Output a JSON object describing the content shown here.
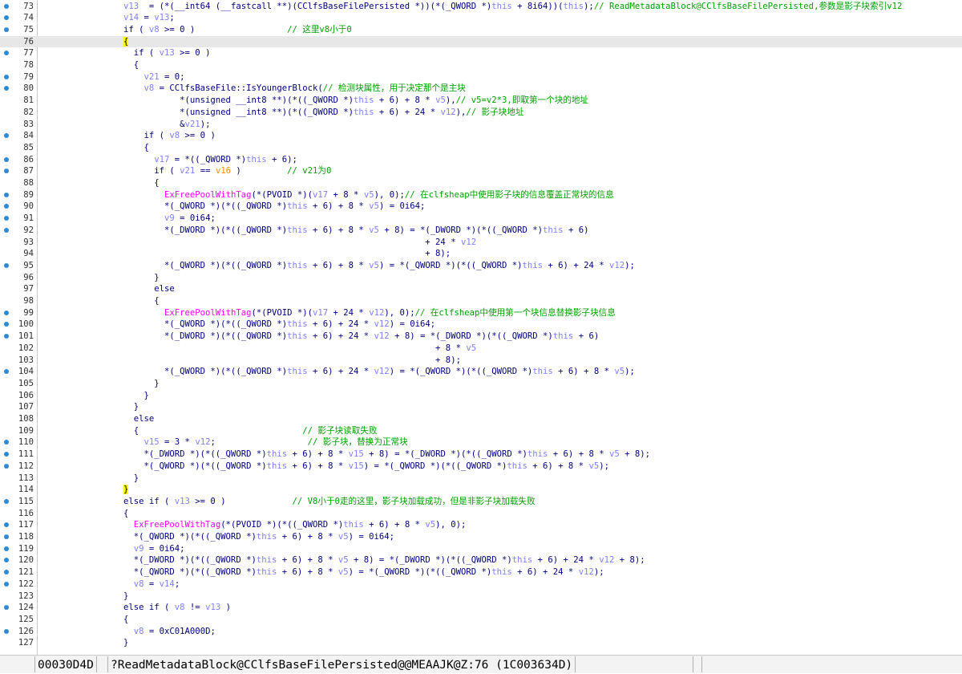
{
  "status_bar": {
    "address": "00030D4D",
    "location": "?ReadMetadataBlock@CClfsBaseFilePersisted@@MEAAJK@Z:76 (1C003634D)"
  },
  "colors": {
    "keyword": "#00007f",
    "variable": "#7f7fff",
    "comment": "#00a000",
    "import_function": "#ff00ff",
    "highlight": "#ffff00",
    "current_line": "#e7e7e7",
    "breakpoint_dot": "#2c8ad8"
  },
  "lines": [
    {
      "n": "73",
      "dot": true,
      "segs": [
        [
          "v",
          "v13"
        ],
        [
          "",
          "  = (*(__int64 (__fastcall **)(CClfsBaseFilePersisted *))(*(_QWORD *)"
        ],
        [
          "v",
          "this"
        ],
        [
          "",
          " + 8i64))("
        ],
        [
          "v",
          "this"
        ],
        [
          "",
          ");"
        ],
        [
          "c",
          "// ReadMetadataBlock@CClfsBaseFilePersisted,参数是影子块索引v12"
        ]
      ]
    },
    {
      "n": "74",
      "dot": true,
      "segs": [
        [
          "v",
          "v14"
        ],
        [
          "",
          " = "
        ],
        [
          "v",
          "v13"
        ],
        [
          "",
          ";"
        ]
      ]
    },
    {
      "n": "75",
      "dot": true,
      "segs": [
        [
          "",
          "if ( "
        ],
        [
          "v",
          "v8"
        ],
        [
          "",
          " >= 0 )                  "
        ],
        [
          "c",
          "// 这里v8小于0"
        ]
      ]
    },
    {
      "n": "76",
      "dot": false,
      "current": true,
      "segs": [
        [
          "hl",
          "{"
        ]
      ]
    },
    {
      "n": "77",
      "dot": true,
      "segs": [
        [
          "",
          "  if ( "
        ],
        [
          "v",
          "v13"
        ],
        [
          "",
          " >= 0 )"
        ]
      ]
    },
    {
      "n": "78",
      "dot": false,
      "segs": [
        [
          "",
          "  {"
        ]
      ]
    },
    {
      "n": "79",
      "dot": true,
      "segs": [
        [
          "",
          "    "
        ],
        [
          "v",
          "v21"
        ],
        [
          "",
          " = 0;"
        ]
      ]
    },
    {
      "n": "80",
      "dot": true,
      "segs": [
        [
          "",
          "    "
        ],
        [
          "v",
          "v8"
        ],
        [
          "",
          " = CClfsBaseFile::IsYoungerBlock("
        ],
        [
          "c",
          "// 检测块属性，用于决定那个是主块"
        ]
      ]
    },
    {
      "n": "81",
      "dot": false,
      "segs": [
        [
          "",
          "           *(unsigned __int8 **)(*((_QWORD *)"
        ],
        [
          "v",
          "this"
        ],
        [
          "",
          " + 6) + 8 * "
        ],
        [
          "v",
          "v5"
        ],
        [
          "",
          "),"
        ],
        [
          "c",
          "// v5=v2*3,即取第一个块的地址"
        ]
      ]
    },
    {
      "n": "82",
      "dot": false,
      "segs": [
        [
          "",
          "           *(unsigned __int8 **)(*((_QWORD *)"
        ],
        [
          "v",
          "this"
        ],
        [
          "",
          " + 6) + 24 * "
        ],
        [
          "v",
          "v12"
        ],
        [
          "",
          "),"
        ],
        [
          "c",
          "// 影子块地址"
        ]
      ]
    },
    {
      "n": "83",
      "dot": false,
      "segs": [
        [
          "",
          "           &"
        ],
        [
          "v",
          "v21"
        ],
        [
          "",
          ");"
        ]
      ]
    },
    {
      "n": "84",
      "dot": true,
      "segs": [
        [
          "",
          "    if ( "
        ],
        [
          "v",
          "v8"
        ],
        [
          "",
          " >= 0 )"
        ]
      ]
    },
    {
      "n": "85",
      "dot": false,
      "segs": [
        [
          "",
          "    {"
        ]
      ]
    },
    {
      "n": "86",
      "dot": true,
      "segs": [
        [
          "",
          "      "
        ],
        [
          "v",
          "v17"
        ],
        [
          "",
          " = *((_QWORD *)"
        ],
        [
          "v",
          "this"
        ],
        [
          "",
          " + 6);"
        ]
      ]
    },
    {
      "n": "87",
      "dot": true,
      "segs": [
        [
          "",
          "      if ( "
        ],
        [
          "v",
          "v21"
        ],
        [
          "",
          " == "
        ],
        [
          "o",
          "v16"
        ],
        [
          "",
          " )         "
        ],
        [
          "c",
          "// v21为0"
        ]
      ]
    },
    {
      "n": "88",
      "dot": false,
      "segs": [
        [
          "",
          "      {"
        ]
      ]
    },
    {
      "n": "89",
      "dot": true,
      "segs": [
        [
          "",
          "        "
        ],
        [
          "f",
          "ExFreePoolWithTag"
        ],
        [
          "",
          "(*(PVOID *)("
        ],
        [
          "v",
          "v17"
        ],
        [
          "",
          " + 8 * "
        ],
        [
          "v",
          "v5"
        ],
        [
          "",
          "), 0);"
        ],
        [
          "c",
          "// 在clfsheap中使用影子块的信息覆盖正常块的信息"
        ]
      ]
    },
    {
      "n": "90",
      "dot": true,
      "segs": [
        [
          "",
          "        *(_QWORD *)(*((_QWORD *)"
        ],
        [
          "v",
          "this"
        ],
        [
          "",
          " + 6) + 8 * "
        ],
        [
          "v",
          "v5"
        ],
        [
          "",
          ") = 0i64;"
        ]
      ]
    },
    {
      "n": "91",
      "dot": true,
      "segs": [
        [
          "",
          "        "
        ],
        [
          "v",
          "v9"
        ],
        [
          "",
          " = 0i64;"
        ]
      ]
    },
    {
      "n": "92",
      "dot": true,
      "segs": [
        [
          "",
          "        *(_DWORD *)(*((_QWORD *)"
        ],
        [
          "v",
          "this"
        ],
        [
          "",
          " + 6) + 8 * "
        ],
        [
          "v",
          "v5"
        ],
        [
          "",
          " + 8) = *(_DWORD *)(*((_QWORD *)"
        ],
        [
          "v",
          "this"
        ],
        [
          "",
          " + 6)"
        ]
      ]
    },
    {
      "n": "93",
      "dot": false,
      "segs": [
        [
          "",
          "                                                           + 24 * "
        ],
        [
          "v",
          "v12"
        ]
      ]
    },
    {
      "n": "94",
      "dot": false,
      "segs": [
        [
          "",
          "                                                           + 8);"
        ]
      ]
    },
    {
      "n": "95",
      "dot": true,
      "segs": [
        [
          "",
          "        *(_QWORD *)(*((_QWORD *)"
        ],
        [
          "v",
          "this"
        ],
        [
          "",
          " + 6) + 8 * "
        ],
        [
          "v",
          "v5"
        ],
        [
          "",
          ") = *(_QWORD *)(*((_QWORD *)"
        ],
        [
          "v",
          "this"
        ],
        [
          "",
          " + 6) + 24 * "
        ],
        [
          "v",
          "v12"
        ],
        [
          "",
          ");"
        ]
      ]
    },
    {
      "n": "96",
      "dot": false,
      "segs": [
        [
          "",
          "      }"
        ]
      ]
    },
    {
      "n": "97",
      "dot": false,
      "segs": [
        [
          "",
          "      else"
        ]
      ]
    },
    {
      "n": "98",
      "dot": false,
      "segs": [
        [
          "",
          "      {"
        ]
      ]
    },
    {
      "n": "99",
      "dot": true,
      "segs": [
        [
          "",
          "        "
        ],
        [
          "f",
          "ExFreePoolWithTag"
        ],
        [
          "",
          "(*(PVOID *)("
        ],
        [
          "v",
          "v17"
        ],
        [
          "",
          " + 24 * "
        ],
        [
          "v",
          "v12"
        ],
        [
          "",
          "), 0);"
        ],
        [
          "c",
          "// 在clfsheap中使用第一个块信息替换影子块信息"
        ]
      ]
    },
    {
      "n": "100",
      "dot": true,
      "segs": [
        [
          "",
          "        *(_QWORD *)(*((_QWORD *)"
        ],
        [
          "v",
          "this"
        ],
        [
          "",
          " + 6) + 24 * "
        ],
        [
          "v",
          "v12"
        ],
        [
          "",
          ") = 0i64;"
        ]
      ]
    },
    {
      "n": "101",
      "dot": true,
      "segs": [
        [
          "",
          "        *(_DWORD *)(*((_QWORD *)"
        ],
        [
          "v",
          "this"
        ],
        [
          "",
          " + 6) + 24 * "
        ],
        [
          "v",
          "v12"
        ],
        [
          "",
          " + 8) = *(_DWORD *)(*((_QWORD *)"
        ],
        [
          "v",
          "this"
        ],
        [
          "",
          " + 6)"
        ]
      ]
    },
    {
      "n": "102",
      "dot": false,
      "segs": [
        [
          "",
          "                                                             + 8 * "
        ],
        [
          "v",
          "v5"
        ]
      ]
    },
    {
      "n": "103",
      "dot": false,
      "segs": [
        [
          "",
          "                                                             + 8);"
        ]
      ]
    },
    {
      "n": "104",
      "dot": true,
      "segs": [
        [
          "",
          "        *(_QWORD *)(*((_QWORD *)"
        ],
        [
          "v",
          "this"
        ],
        [
          "",
          " + 6) + 24 * "
        ],
        [
          "v",
          "v12"
        ],
        [
          "",
          ") = *(_QWORD *)(*((_QWORD *)"
        ],
        [
          "v",
          "this"
        ],
        [
          "",
          " + 6) + 8 * "
        ],
        [
          "v",
          "v5"
        ],
        [
          "",
          ");"
        ]
      ]
    },
    {
      "n": "105",
      "dot": false,
      "segs": [
        [
          "",
          "      }"
        ]
      ]
    },
    {
      "n": "106",
      "dot": false,
      "segs": [
        [
          "",
          "    }"
        ]
      ]
    },
    {
      "n": "107",
      "dot": false,
      "segs": [
        [
          "",
          "  }"
        ]
      ]
    },
    {
      "n": "108",
      "dot": false,
      "segs": [
        [
          "",
          "  else"
        ]
      ]
    },
    {
      "n": "109",
      "dot": false,
      "segs": [
        [
          "",
          "  {                                "
        ],
        [
          "c",
          "// 影子块读取失败"
        ]
      ]
    },
    {
      "n": "110",
      "dot": true,
      "segs": [
        [
          "",
          "    "
        ],
        [
          "v",
          "v15"
        ],
        [
          "",
          " = 3 * "
        ],
        [
          "v",
          "v12"
        ],
        [
          "",
          ";                  "
        ],
        [
          "c",
          "// 影子块，替换为正常块"
        ]
      ]
    },
    {
      "n": "111",
      "dot": true,
      "segs": [
        [
          "",
          "    *(_DWORD *)(*((_QWORD *)"
        ],
        [
          "v",
          "this"
        ],
        [
          "",
          " + 6) + 8 * "
        ],
        [
          "v",
          "v15"
        ],
        [
          "",
          " + 8) = *(_DWORD *)(*((_QWORD *)"
        ],
        [
          "v",
          "this"
        ],
        [
          "",
          " + 6) + 8 * "
        ],
        [
          "v",
          "v5"
        ],
        [
          "",
          " + 8);"
        ]
      ]
    },
    {
      "n": "112",
      "dot": true,
      "segs": [
        [
          "",
          "    *(_QWORD *)(*((_QWORD *)"
        ],
        [
          "v",
          "this"
        ],
        [
          "",
          " + 6) + 8 * "
        ],
        [
          "v",
          "v15"
        ],
        [
          "",
          ") = *(_QWORD *)(*((_QWORD *)"
        ],
        [
          "v",
          "this"
        ],
        [
          "",
          " + 6) + 8 * "
        ],
        [
          "v",
          "v5"
        ],
        [
          "",
          ");"
        ]
      ]
    },
    {
      "n": "113",
      "dot": false,
      "segs": [
        [
          "",
          "  }"
        ]
      ]
    },
    {
      "n": "114",
      "dot": false,
      "segs": [
        [
          "hl",
          "}"
        ]
      ]
    },
    {
      "n": "115",
      "dot": true,
      "segs": [
        [
          "",
          "else if ( "
        ],
        [
          "v",
          "v13"
        ],
        [
          "",
          " >= 0 )             "
        ],
        [
          "c",
          "// V8小于0走的这里，影子块加载成功，但是非影子块加载失败"
        ]
      ]
    },
    {
      "n": "116",
      "dot": false,
      "segs": [
        [
          "",
          "{"
        ]
      ]
    },
    {
      "n": "117",
      "dot": true,
      "segs": [
        [
          "",
          "  "
        ],
        [
          "f",
          "ExFreePoolWithTag"
        ],
        [
          "",
          "(*(PVOID *)(*((_QWORD *)"
        ],
        [
          "v",
          "this"
        ],
        [
          "",
          " + 6) + 8 * "
        ],
        [
          "v",
          "v5"
        ],
        [
          "",
          "), 0);"
        ]
      ]
    },
    {
      "n": "118",
      "dot": true,
      "segs": [
        [
          "",
          "  *(_QWORD *)(*((_QWORD *)"
        ],
        [
          "v",
          "this"
        ],
        [
          "",
          " + 6) + 8 * "
        ],
        [
          "v",
          "v5"
        ],
        [
          "",
          ") = 0i64;"
        ]
      ]
    },
    {
      "n": "119",
      "dot": true,
      "segs": [
        [
          "",
          "  "
        ],
        [
          "v",
          "v9"
        ],
        [
          "",
          " = 0i64;"
        ]
      ]
    },
    {
      "n": "120",
      "dot": true,
      "segs": [
        [
          "",
          "  *(_DWORD *)(*((_QWORD *)"
        ],
        [
          "v",
          "this"
        ],
        [
          "",
          " + 6) + 8 * "
        ],
        [
          "v",
          "v5"
        ],
        [
          "",
          " + 8) = *(_DWORD *)(*((_QWORD *)"
        ],
        [
          "v",
          "this"
        ],
        [
          "",
          " + 6) + 24 * "
        ],
        [
          "v",
          "v12"
        ],
        [
          "",
          " + 8);"
        ]
      ]
    },
    {
      "n": "121",
      "dot": true,
      "segs": [
        [
          "",
          "  *(_QWORD *)(*((_QWORD *)"
        ],
        [
          "v",
          "this"
        ],
        [
          "",
          " + 6) + 8 * "
        ],
        [
          "v",
          "v5"
        ],
        [
          "",
          ") = *(_QWORD *)(*((_QWORD *)"
        ],
        [
          "v",
          "this"
        ],
        [
          "",
          " + 6) + 24 * "
        ],
        [
          "v",
          "v12"
        ],
        [
          "",
          ");"
        ]
      ]
    },
    {
      "n": "122",
      "dot": true,
      "segs": [
        [
          "",
          "  "
        ],
        [
          "v",
          "v8"
        ],
        [
          "",
          " = "
        ],
        [
          "v",
          "v14"
        ],
        [
          "",
          ";"
        ]
      ]
    },
    {
      "n": "123",
      "dot": false,
      "segs": [
        [
          "",
          "}"
        ]
      ]
    },
    {
      "n": "124",
      "dot": true,
      "segs": [
        [
          "",
          "else if ( "
        ],
        [
          "v",
          "v8"
        ],
        [
          "",
          " != "
        ],
        [
          "v",
          "v13"
        ],
        [
          "",
          " )"
        ]
      ]
    },
    {
      "n": "125",
      "dot": false,
      "segs": [
        [
          "",
          "{"
        ]
      ]
    },
    {
      "n": "126",
      "dot": true,
      "segs": [
        [
          "",
          "  "
        ],
        [
          "v",
          "v8"
        ],
        [
          "",
          " = 0xC01A000D;"
        ]
      ]
    },
    {
      "n": "127",
      "dot": false,
      "segs": [
        [
          "",
          "}"
        ]
      ]
    }
  ]
}
